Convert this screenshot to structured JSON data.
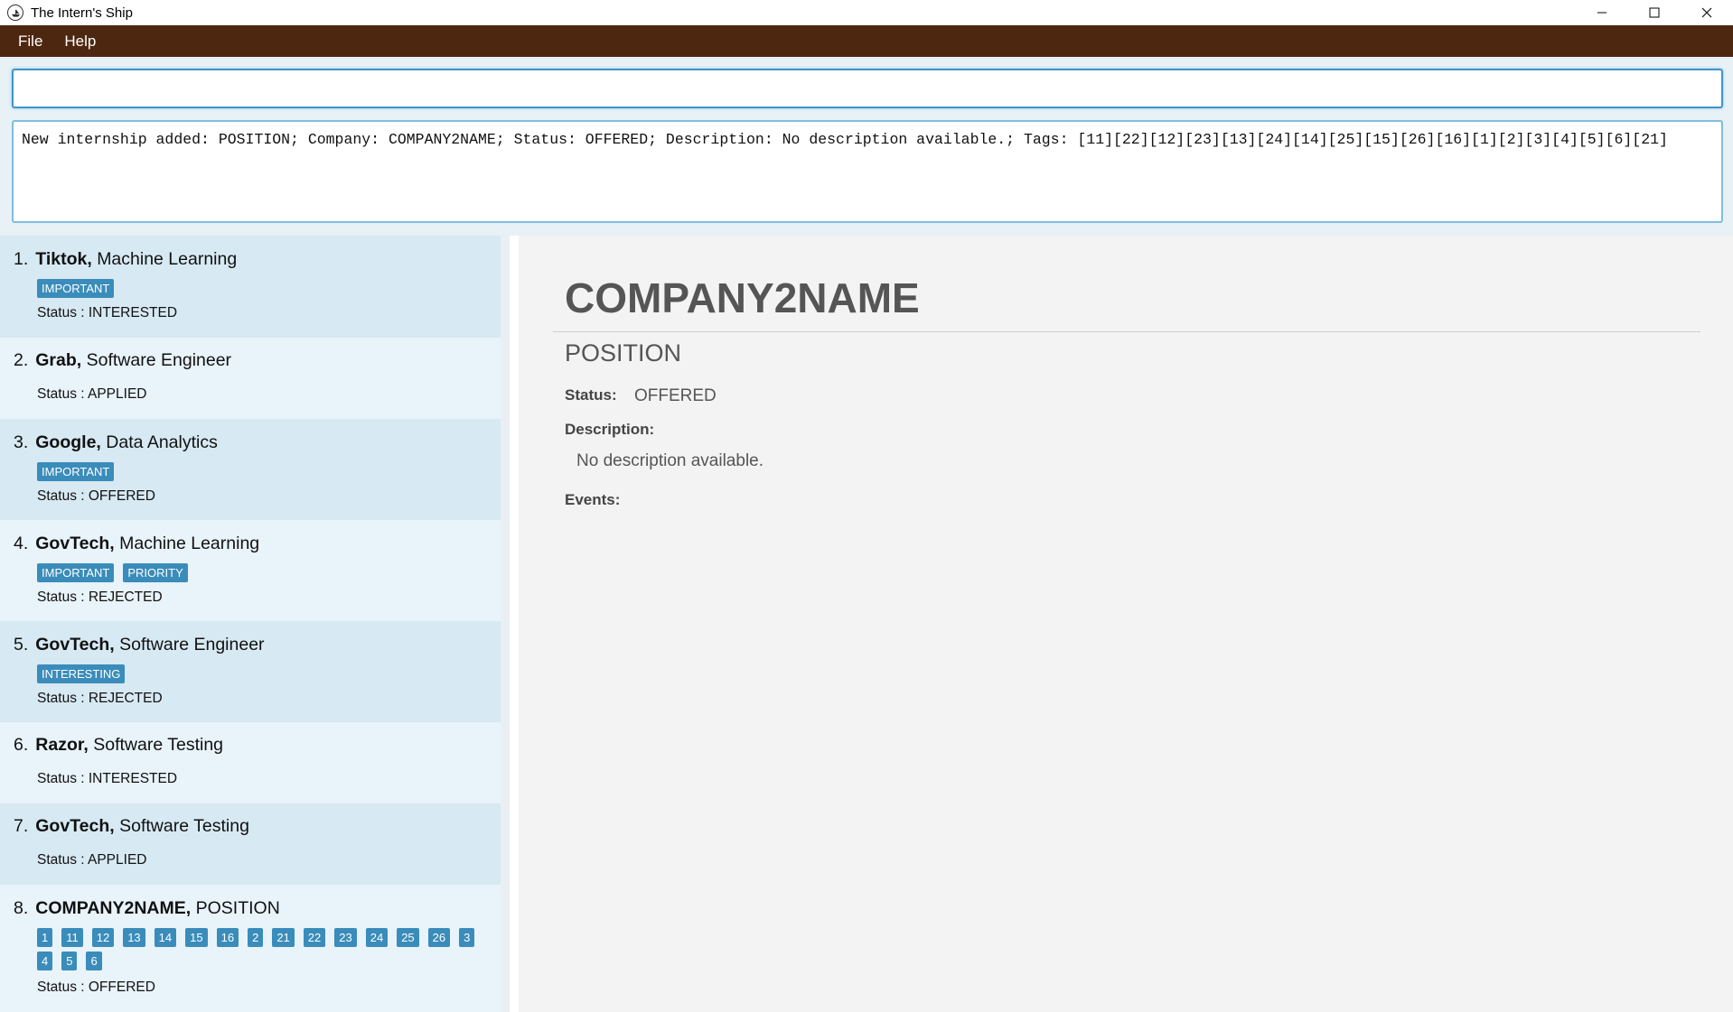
{
  "window": {
    "title": "The Intern's Ship"
  },
  "menu": {
    "items": [
      "File",
      "Help"
    ]
  },
  "command": {
    "value": "",
    "placeholder": ""
  },
  "result": {
    "text": "New internship added: POSITION; Company: COMPANY2NAME; Status: OFFERED; Description: No description available.; Tags: [11][22][12][23][13][24][14][25][15][26][16][1][2][3][4][5][6][21]"
  },
  "list": [
    {
      "index": "1.",
      "company": "Tiktok,",
      "role": "Machine Learning",
      "tags": [
        "IMPORTANT"
      ],
      "status": "Status : INTERESTED"
    },
    {
      "index": "2.",
      "company": "Grab,",
      "role": "Software Engineer",
      "tags": [],
      "status": "Status : APPLIED"
    },
    {
      "index": "3.",
      "company": "Google,",
      "role": "Data Analytics",
      "tags": [
        "IMPORTANT"
      ],
      "status": "Status : OFFERED"
    },
    {
      "index": "4.",
      "company": "GovTech,",
      "role": "Machine Learning",
      "tags": [
        "IMPORTANT",
        "PRIORITY"
      ],
      "status": "Status : REJECTED"
    },
    {
      "index": "5.",
      "company": "GovTech,",
      "role": "Software Engineer",
      "tags": [
        "INTERESTING"
      ],
      "status": "Status : REJECTED"
    },
    {
      "index": "6.",
      "company": "Razor,",
      "role": "Software Testing",
      "tags": [],
      "status": "Status : INTERESTED"
    },
    {
      "index": "7.",
      "company": "GovTech,",
      "role": "Software Testing",
      "tags": [],
      "status": "Status : APPLIED"
    },
    {
      "index": "8.",
      "company": "COMPANY2NAME,",
      "role": "POSITION",
      "tags": [
        "1",
        "11",
        "12",
        "13",
        "14",
        "15",
        "16",
        "2",
        "21",
        "22",
        "23",
        "24",
        "25",
        "26",
        "3",
        "4",
        "5",
        "6"
      ],
      "status": "Status : OFFERED"
    }
  ],
  "detail": {
    "company": "COMPANY2NAME",
    "position": "POSITION",
    "status_label": "Status:",
    "status_value": "OFFERED",
    "description_label": "Description:",
    "description_value": "No description available.",
    "events_label": "Events:"
  },
  "colors": {
    "menubar": "#4e2711",
    "tag": "#3a8cba",
    "focus_border": "#3d97c8"
  },
  "icons": [
    "app-logo-icon",
    "minimize-icon",
    "maximize-icon",
    "close-icon"
  ]
}
